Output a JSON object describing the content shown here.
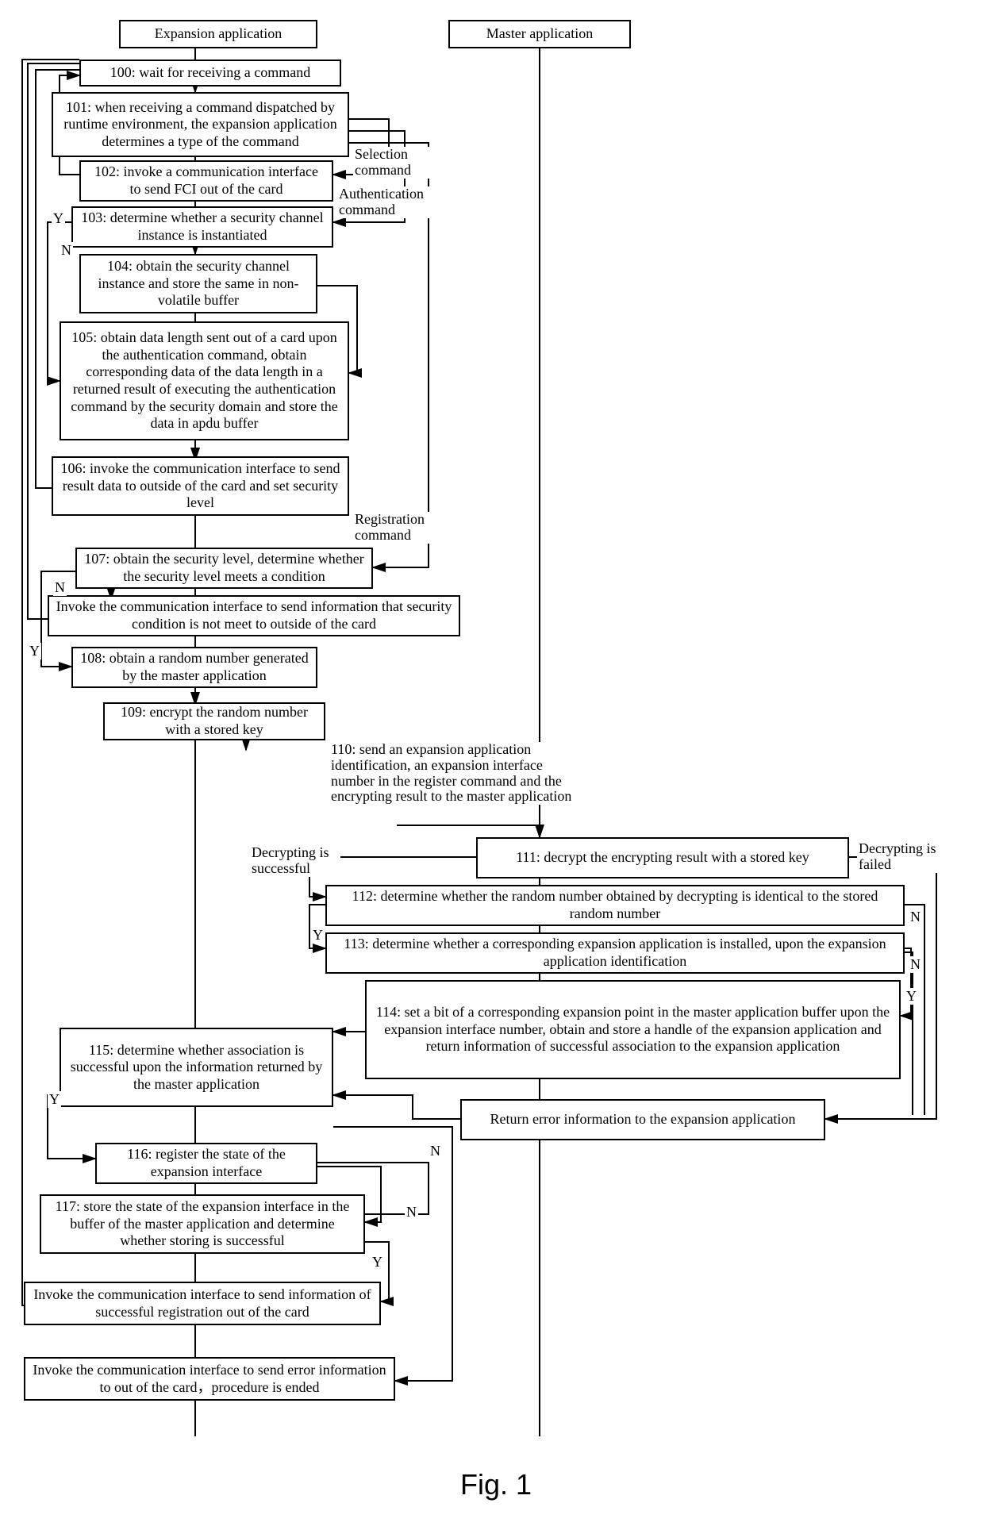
{
  "headers": {
    "expansion": "Expansion application",
    "master": "Master application"
  },
  "steps": {
    "s100": "100: wait for receiving a command",
    "s101": "101: when receiving a command dispatched by runtime environment, the expansion application determines a type of the command",
    "s102": "102: invoke a communication interface to send FCI out of the card",
    "s103": "103: determine whether a security channel instance is instantiated",
    "s104": "104:  obtain the security channel instance and store the same in non-volatile buffer",
    "s105": "105: obtain data length sent out of a card upon the authentication command, obtain corresponding data of the data length in a returned result of executing the authentication command by the security domain and store the data in apdu buffer",
    "s106": "106: invoke the communication interface to send result data to outside of the card and set security level",
    "s107": "107: obtain the security level, determine whether the security level meets a condition",
    "s107fail": "Invoke the communication interface to send information that security condition is not meet to outside of the card",
    "s108": "108: obtain a random number generated by the master application",
    "s109": "109: encrypt the random number with a stored key",
    "s110": "110: send an expansion application identification, an expansion interface number in the register command and the encrypting result  to the master application",
    "s111": "111: decrypt the encrypting result with a stored key",
    "s112": "112: determine whether the random number obtained by decrypting is identical to the stored random number",
    "s113": "113: determine whether a corresponding expansion application is installed, upon the expansion application identification",
    "s114": "114: set a bit of a corresponding expansion point in the master application buffer upon the expansion interface number, obtain and store a handle of the expansion application and return information of successful association to the expansion application",
    "s115": "115: determine whether association is successful upon the information returned by the master application",
    "returnErr": "Return error information to the expansion application",
    "s116": "116: register the state of the expansion interface",
    "s117": "117: store the state of the expansion interface in the buffer of the master application and determine whether storing is successful",
    "sendSuccess": "Invoke the communication interface to send information of successful registration out of the card",
    "sendError": "Invoke the communication interface to send error information to out of the card，procedure is ended"
  },
  "labels": {
    "selectionCmd": "Selection command",
    "authCmd": "Authentication command",
    "regCmd": "Registration command",
    "decryptOk": "Decrypting is successful",
    "decryptFail": "Decrypting is failed",
    "Y": "Y",
    "N": "N"
  },
  "caption": "Fig. 1"
}
